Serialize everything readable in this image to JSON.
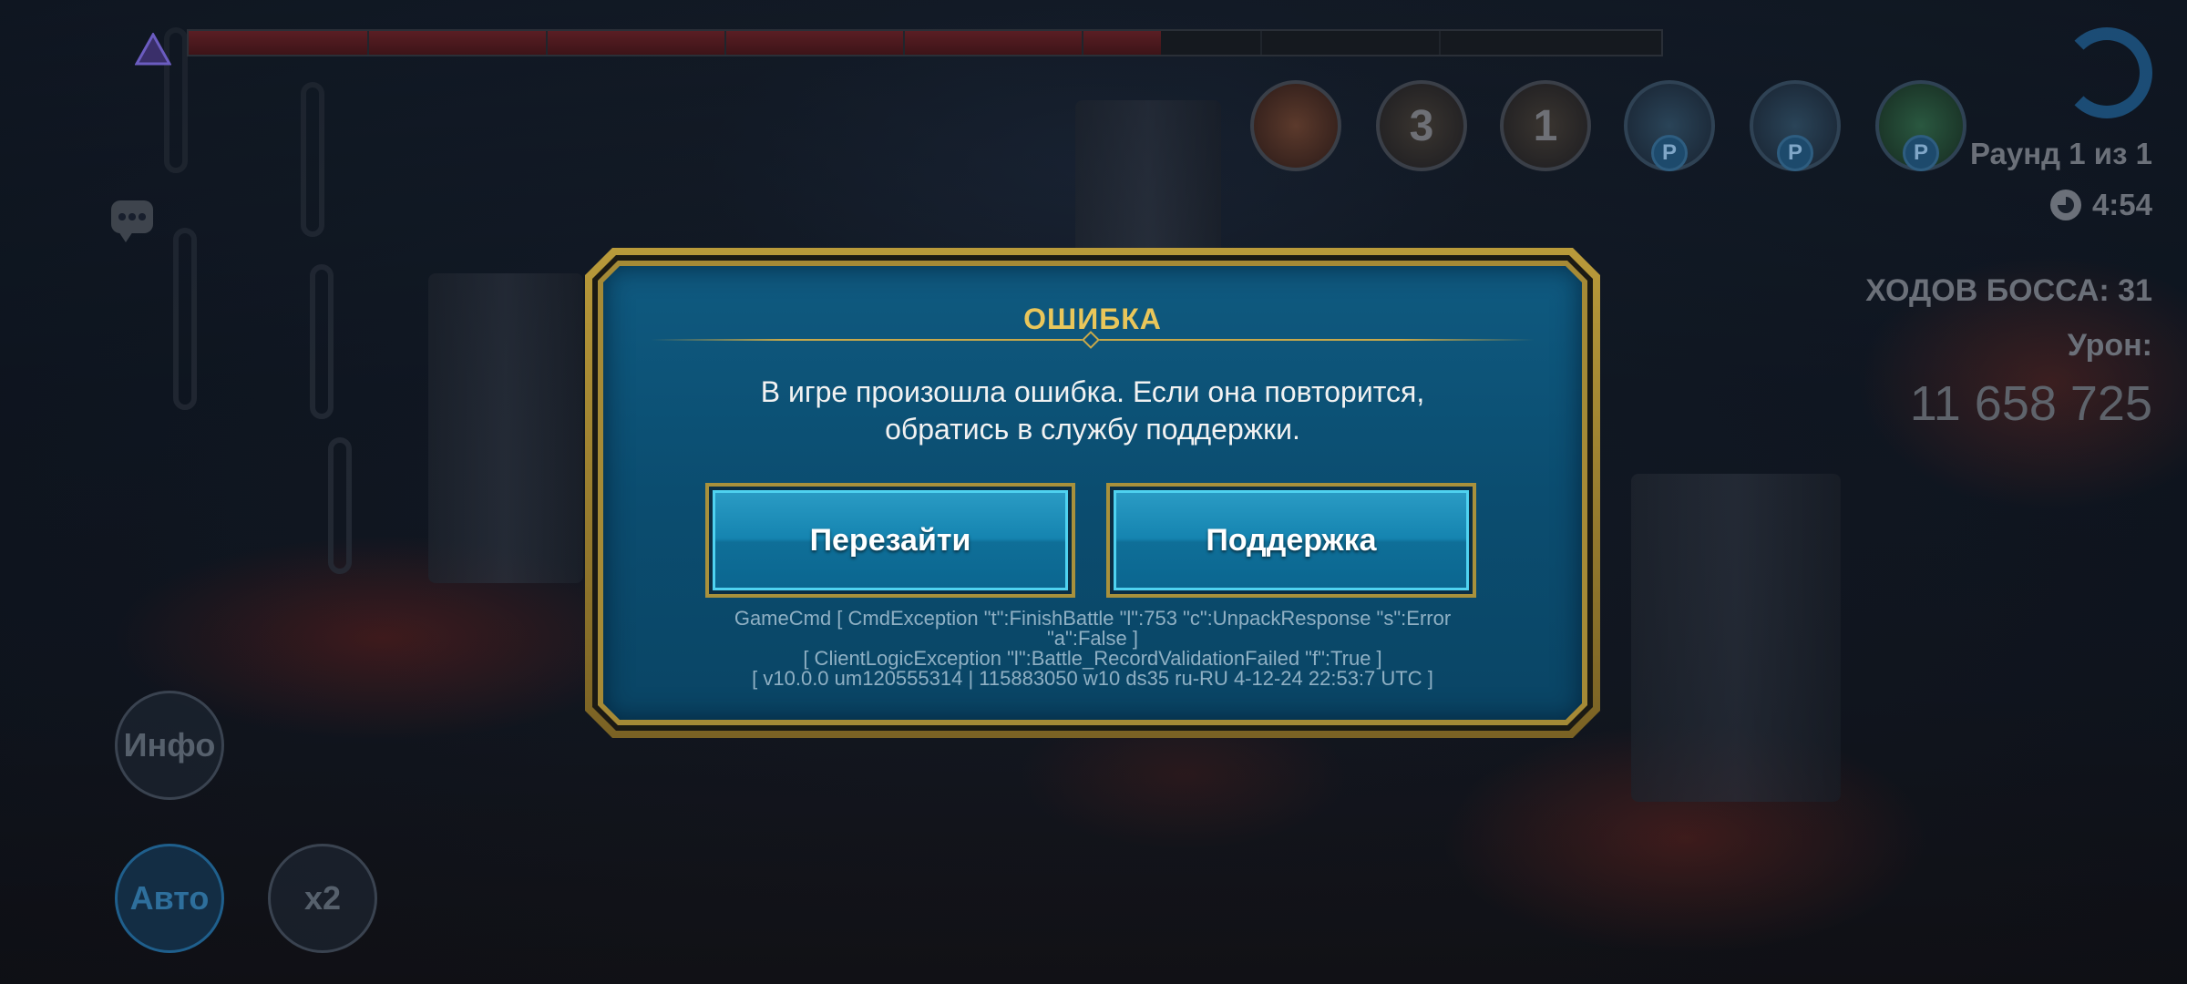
{
  "hud": {
    "round": "Раунд 1 из 1",
    "timer": "4:54",
    "boss_turns": "ХОДОВ БОССА: 31",
    "damage_label": "Урон:",
    "damage_value": "11 658 725",
    "health_bar_fill": 0.66
  },
  "turn_order": [
    {
      "icon": "hero-portrait-icon",
      "text": ""
    },
    {
      "icon": "turn-counter",
      "text": "3"
    },
    {
      "icon": "turn-counter",
      "text": "1"
    },
    {
      "icon": "buff-icon",
      "text": "P"
    },
    {
      "icon": "buff-icon",
      "text": "P"
    },
    {
      "icon": "buff-icon",
      "text": "P"
    }
  ],
  "controls": {
    "info": "Инфо",
    "auto": "Авто",
    "speed": "x2"
  },
  "dialog": {
    "title": "ОШИБКА",
    "message_line1": "В игре произошла ошибка. Если она повторится,",
    "message_line2": "обратись в службу поддержки.",
    "relog_button": "Перезайти",
    "support_button": "Поддержка",
    "log_line1": "GameCmd [ CmdException \"t\":FinishBattle \"l\":753 \"c\":UnpackResponse \"s\":Error",
    "log_line2": "\"a\":False ]",
    "log_line3": "[ ClientLogicException \"l\":Battle_RecordValidationFailed \"f\":True ]",
    "log_line4": "[ v10.0.0  um120555314 | 115883050  w10  ds35  ru-RU  4-12-24 22:53:7 UTC ]"
  },
  "colors": {
    "dialog_gold": "#b99a3a",
    "dialog_blue": "#0f5a80",
    "title_gold": "#e9c65a",
    "button_blue": "#1584b0"
  }
}
